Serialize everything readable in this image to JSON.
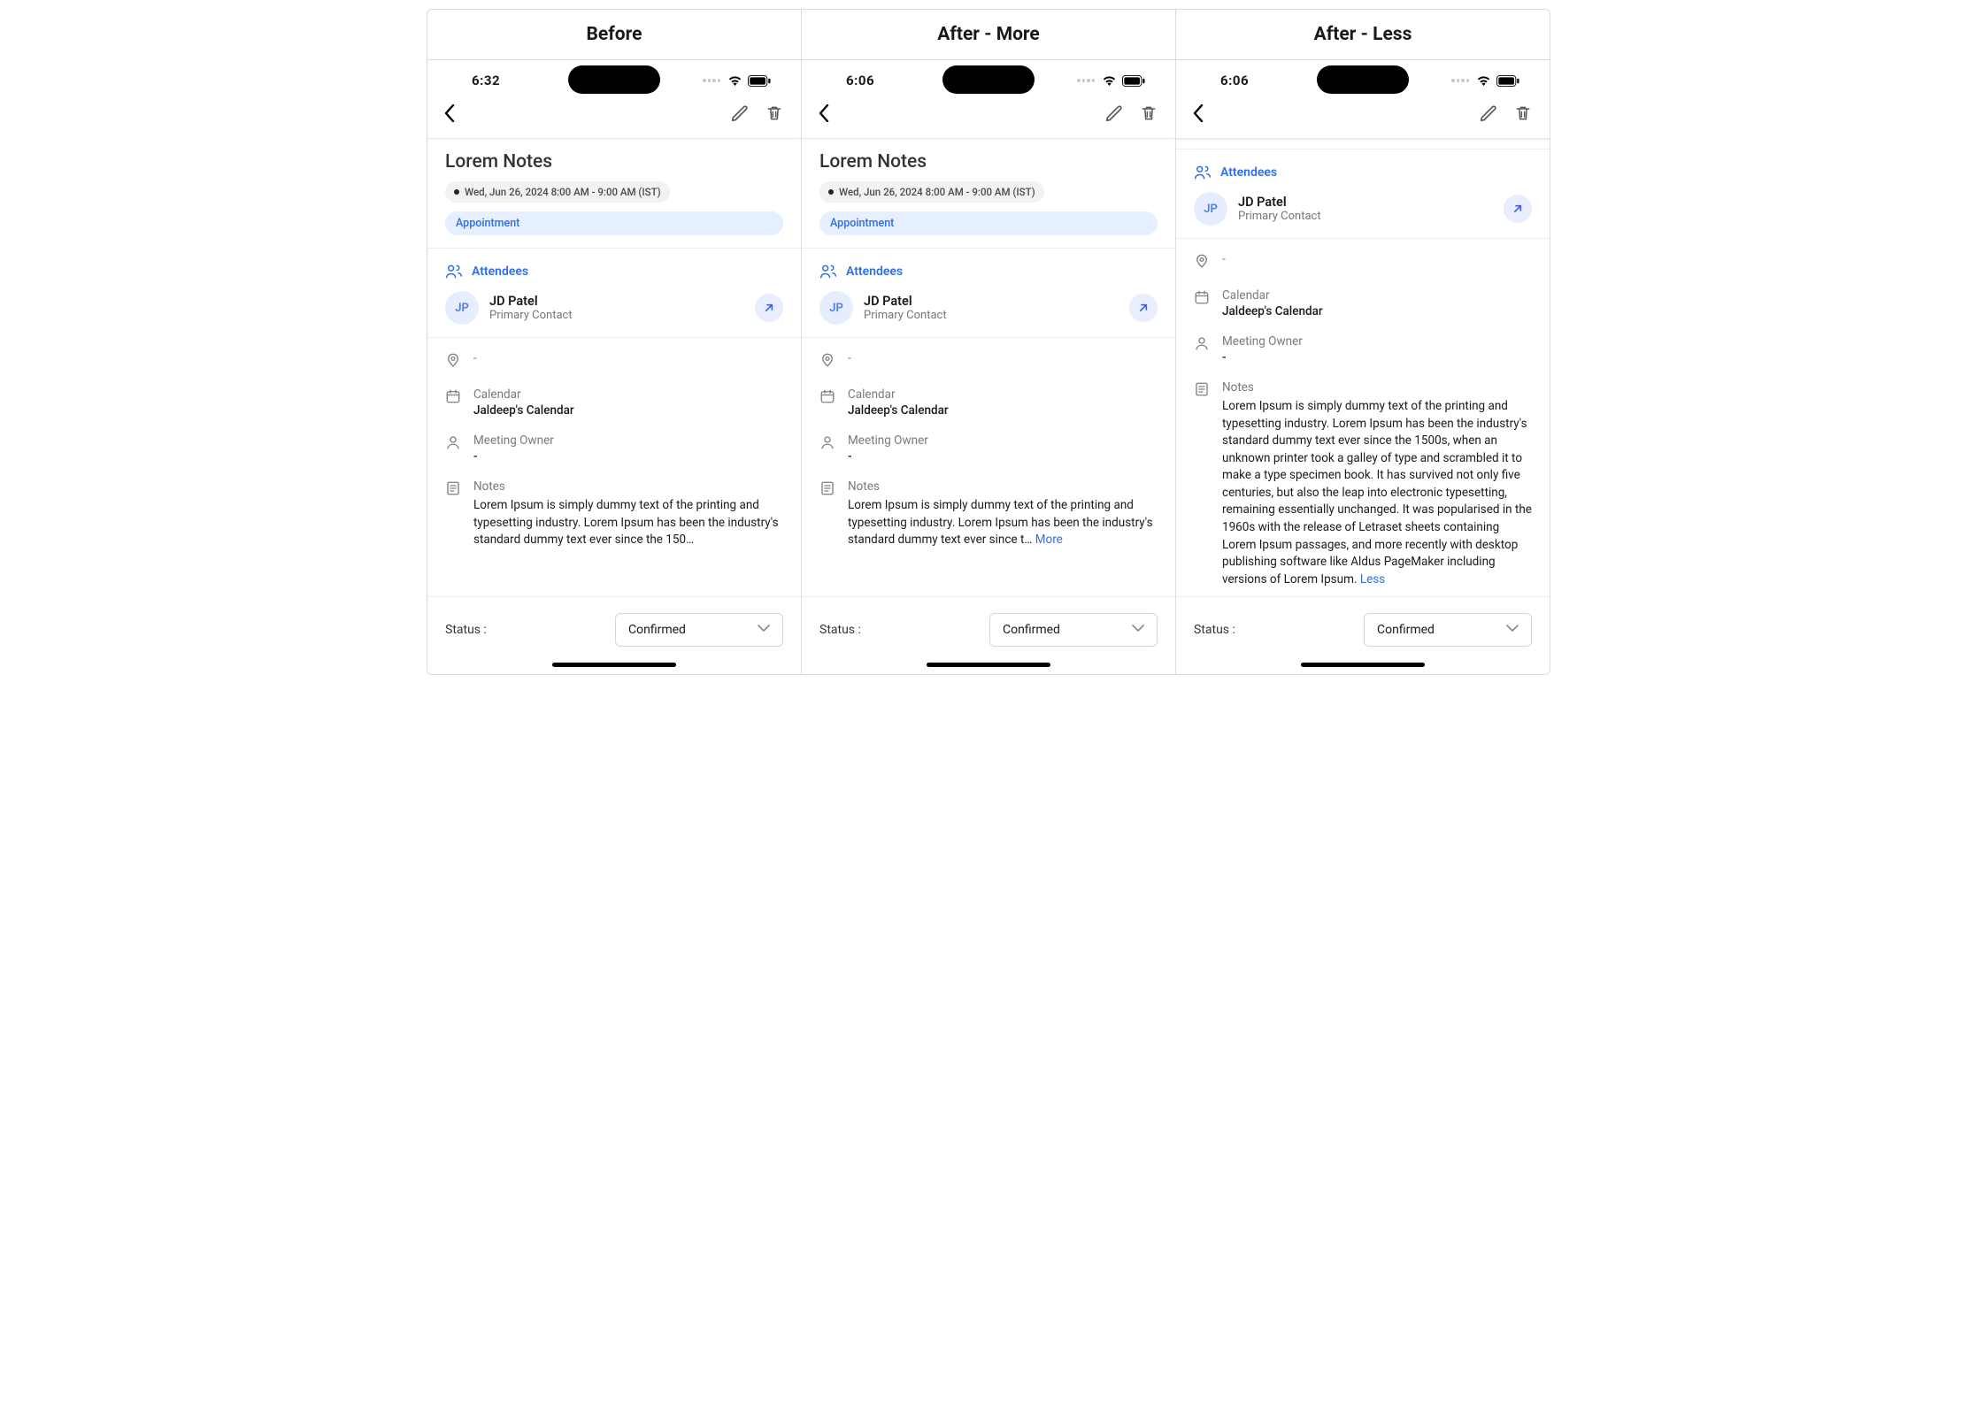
{
  "panels": [
    {
      "header": "Before",
      "time": "6:32"
    },
    {
      "header": "After - More",
      "time": "6:06"
    },
    {
      "header": "After - Less",
      "time": "6:06"
    }
  ],
  "event": {
    "title": "Lorem Notes",
    "datetime": "Wed, Jun 26, 2024 8:00 AM - 9:00 AM (IST)",
    "type_chip": "Appointment"
  },
  "attendees": {
    "section_label": "Attendees",
    "items": [
      {
        "initials": "JP",
        "name": "JD Patel",
        "role": "Primary Contact"
      }
    ]
  },
  "fields": {
    "location_value": "-",
    "calendar_label": "Calendar",
    "calendar_value": "Jaldeep's Calendar",
    "owner_label": "Meeting Owner",
    "owner_value": "-",
    "notes_label": "Notes",
    "notes_truncated_before": "Lorem Ipsum is simply dummy text of the printing and typesetting industry. Lorem Ipsum has been the industry's standard dummy text ever since the 150…",
    "notes_truncated_more": "Lorem Ipsum is simply dummy text of the printing and typesetting industry. Lorem Ipsum has been the industry's standard dummy text ever since t… ",
    "more_label": "More",
    "notes_full": "Lorem Ipsum is simply dummy text of the printing and typesetting industry. Lorem Ipsum has been the industry's standard dummy text ever since the 1500s, when an unknown printer took a galley of type and scrambled it to make a type specimen book. It has survived not only five centuries, but also the leap into electronic typesetting, remaining essentially unchanged. It was popularised in the 1960s with the release of Letraset sheets containing Lorem Ipsum passages, and more recently with desktop publishing software like Aldus PageMaker including versions of Lorem Ipsum. ",
    "less_label": "Less"
  },
  "status": {
    "label": "Status :",
    "value": "Confirmed"
  }
}
